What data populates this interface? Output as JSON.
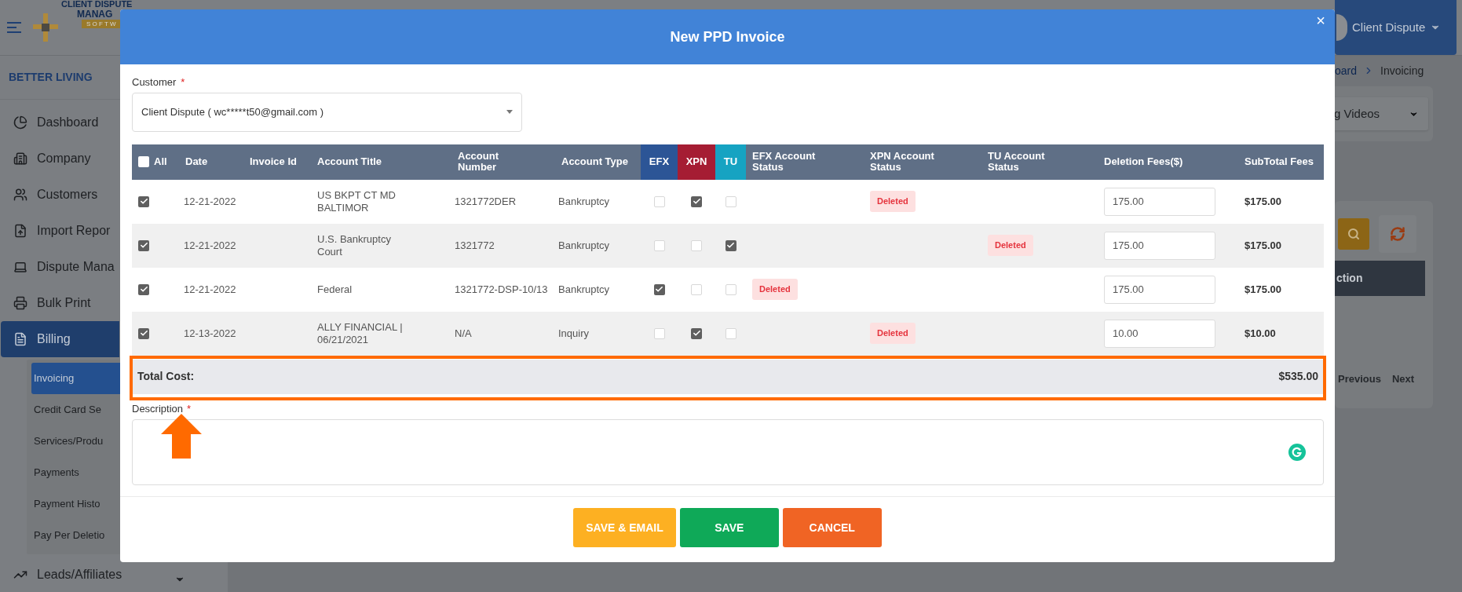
{
  "logo": {
    "lines": [
      "CLIENT DISPUTE",
      "MANAG",
      "S O F T W"
    ]
  },
  "sidebar": {
    "org": "BETTER LIVING",
    "items": [
      {
        "label": "Dashboard",
        "selected": false
      },
      {
        "label": "Company",
        "selected": false
      },
      {
        "label": "Customers",
        "selected": false
      },
      {
        "label": "Import Repor",
        "selected": false
      },
      {
        "label": "Dispute Mana",
        "selected": false
      },
      {
        "label": "Bulk Print",
        "selected": false
      },
      {
        "label": "Billing",
        "selected": true,
        "children": [
          {
            "label": "Invoicing",
            "selected": true
          },
          {
            "label": "Credit Card Se",
            "selected": false
          },
          {
            "label": "Services/Produ",
            "selected": false
          },
          {
            "label": "Payments",
            "selected": false
          },
          {
            "label": "Payment Histo",
            "selected": false
          },
          {
            "label": "Pay Per Deletio",
            "selected": false
          }
        ]
      },
      {
        "label": "Leads/Affiliates",
        "selected": false,
        "expanded": false
      }
    ]
  },
  "user": {
    "name": "Client Dispute"
  },
  "breadcrumb": [
    "oard",
    "Invoicing"
  ],
  "video_select": "g Videos",
  "background_table": {
    "header": "ction",
    "pagination": [
      "Previous",
      "Next"
    ]
  },
  "modal": {
    "title": "New PPD Invoice",
    "close": "×",
    "customer": {
      "label": "Customer",
      "required_mark": "*",
      "value": "Client Dispute ( wc*****t50@gmail.com )"
    },
    "columns": [
      {
        "label": "All",
        "kind": "checkbox",
        "checked": false
      },
      {
        "label": "Date",
        "kind": "text"
      },
      {
        "label": "Invoice Id",
        "kind": "text"
      },
      {
        "label": "Account Title",
        "kind": "text"
      },
      {
        "label": "Account Number",
        "kind": "text"
      },
      {
        "label": "Account Type",
        "kind": "text"
      },
      {
        "label": "EFX",
        "kind": "bureau",
        "color": "#2c5596"
      },
      {
        "label": "XPN",
        "kind": "bureau",
        "color": "#a51d33"
      },
      {
        "label": "TU",
        "kind": "bureau",
        "color": "#16a3c2"
      },
      {
        "label": "EFX Account Status",
        "kind": "text"
      },
      {
        "label": "XPN Account Status",
        "kind": "text"
      },
      {
        "label": "TU Account Status",
        "kind": "text"
      },
      {
        "label": "Deletion Fees($)",
        "kind": "text"
      },
      {
        "label": "SubTotal Fees",
        "kind": "text"
      }
    ],
    "rows": [
      {
        "checked": true,
        "date": "12-21-2022",
        "account_title": "US BKPT CT MD BALTIMOR",
        "account_number": "1321772DER",
        "account_type": "Bankruptcy",
        "efx": false,
        "xpn": true,
        "tu": false,
        "xpn_status": "Deleted",
        "fee": "175.00",
        "subtotal": "$175.00"
      },
      {
        "checked": true,
        "date": "12-21-2022",
        "account_title": "U.S. Bankruptcy Court",
        "account_number": "1321772",
        "account_type": "Bankruptcy",
        "efx": false,
        "xpn": false,
        "tu": true,
        "tu_status": "Deleted",
        "fee": "175.00",
        "subtotal": "$175.00"
      },
      {
        "checked": true,
        "date": "12-21-2022",
        "account_title": "Federal",
        "account_number": "1321772-DSP-10/13",
        "account_type": "Bankruptcy",
        "efx": true,
        "xpn": false,
        "tu": false,
        "efx_status": "Deleted",
        "fee": "175.00",
        "subtotal": "$175.00"
      },
      {
        "checked": true,
        "date": "12-13-2022",
        "account_title": "ALLY FINANCIAL | 06/21/2021",
        "account_number": "N/A",
        "account_type": "Inquiry",
        "efx": false,
        "xpn": true,
        "tu": false,
        "xpn_status": "Deleted",
        "fee": "10.00",
        "subtotal": "$10.00"
      }
    ],
    "total": {
      "label": "Total Cost:",
      "value": "$535.00",
      "highlighted": true
    },
    "description": {
      "label": "Description",
      "required_mark": "*"
    },
    "buttons": [
      {
        "label": "SAVE & EMAIL",
        "kind": "warning"
      },
      {
        "label": "SAVE",
        "kind": "success"
      },
      {
        "label": "CANCEL",
        "kind": "danger"
      }
    ]
  }
}
